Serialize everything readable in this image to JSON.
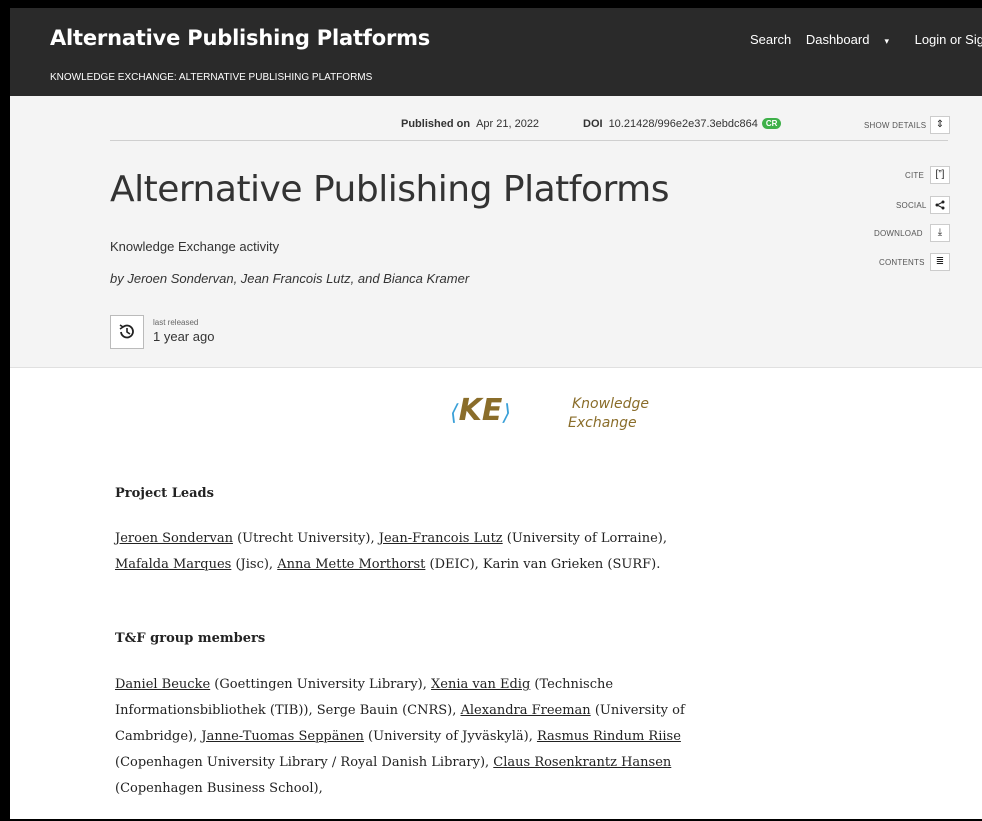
{
  "header": {
    "site_title": "Alternative Publishing Platforms",
    "community": "KNOWLEDGE EXCHANGE: ALTERNATIVE PUBLISHING PLATFORMS",
    "nav": {
      "search": "Search",
      "dashboard": "Dashboard",
      "dashboard_caret": "▾",
      "login": "Login or Signup"
    }
  },
  "meta": {
    "published_label": "Published on",
    "published_date": "Apr 21, 2022",
    "doi_label": "DOI",
    "doi_value": "10.21428/996e2e37.3ebdc864",
    "crossref_badge": "CR",
    "show_details": "SHOW DETAILS"
  },
  "sidebar": {
    "cite": "CITE",
    "social": "SOCIAL",
    "download": "DOWNLOAD",
    "contents": "CONTENTS"
  },
  "pub": {
    "title": "Alternative Publishing Platforms",
    "subtitle": "Knowledge Exchange activity",
    "byline": "by Jeroen Sondervan, Jean Francois Lutz, and Bianca Kramer",
    "released_label": "last released",
    "released_value": "1 year ago"
  },
  "logo": {
    "mark": "KE",
    "line1": "Knowledge",
    "line2": "Exchange"
  },
  "body": {
    "project_leads_heading": "Project Leads",
    "project_leads": [
      {
        "text": "Jeroen Sondervan",
        "link": true
      },
      {
        "text": " (Utrecht University), ",
        "link": false
      },
      {
        "text": "Jean-Francois Lutz",
        "link": true
      },
      {
        "text": " (University of Lorraine), ",
        "link": false
      },
      {
        "text": "Mafalda Marques",
        "link": true
      },
      {
        "text": " (Jisc), ",
        "link": false
      },
      {
        "text": "Anna Mette Morthorst",
        "link": true
      },
      {
        "text": " (DEIC), Karin van Grieken (SURF).",
        "link": false
      }
    ],
    "tf_heading": "T&F group members",
    "tf_members": [
      {
        "text": "Daniel Beucke",
        "link": true
      },
      {
        "text": " (Goettingen University Library), ",
        "link": false
      },
      {
        "text": "Xenia van Edig",
        "link": true
      },
      {
        "text": " (Technische Informationsbibliothek (TIB)), Serge Bauin (CNRS), ",
        "link": false
      },
      {
        "text": "Alexandra Freeman",
        "link": true
      },
      {
        "text": " (University of Cambridge), ",
        "link": false
      },
      {
        "text": "Janne-Tuomas Seppänen",
        "link": true
      },
      {
        "text": " (University of Jyväskylä), ",
        "link": false
      },
      {
        "text": "Rasmus Rindum Riise",
        "link": true
      },
      {
        "text": " (Copenhagen University Library / Royal Danish Library), ",
        "link": false
      },
      {
        "text": "Claus Rosenkrantz Hansen",
        "link": true
      },
      {
        "text": " (Copenhagen Business School),",
        "link": false
      }
    ]
  }
}
